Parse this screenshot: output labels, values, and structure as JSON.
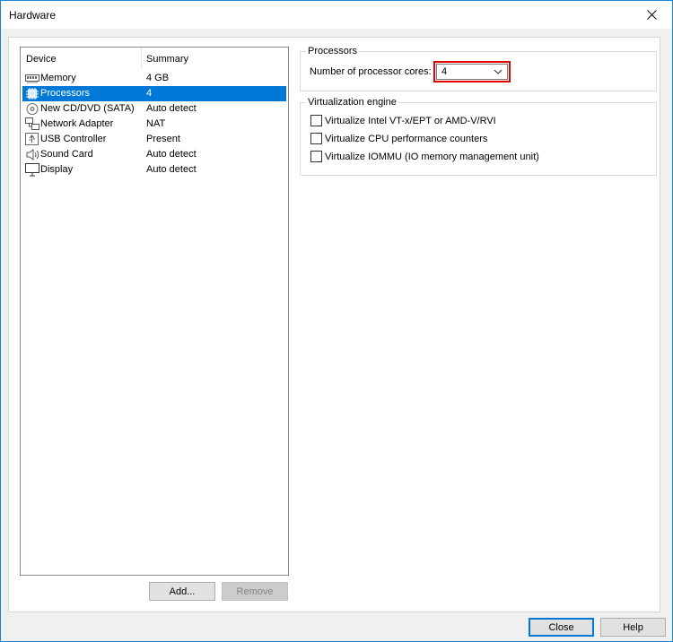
{
  "window": {
    "title": "Hardware"
  },
  "device_list": {
    "columns": [
      "Device",
      "Summary"
    ],
    "items": [
      {
        "device": "Memory",
        "summary": "4 GB",
        "icon": "memory-icon",
        "selected": false
      },
      {
        "device": "Processors",
        "summary": "4",
        "icon": "processor-icon",
        "selected": true
      },
      {
        "device": "New CD/DVD (SATA)",
        "summary": "Auto detect",
        "icon": "cd-dvd-icon",
        "selected": false
      },
      {
        "device": "Network Adapter",
        "summary": "NAT",
        "icon": "network-adapter-icon",
        "selected": false
      },
      {
        "device": "USB Controller",
        "summary": "Present",
        "icon": "usb-icon",
        "selected": false
      },
      {
        "device": "Sound Card",
        "summary": "Auto detect",
        "icon": "sound-card-icon",
        "selected": false
      },
      {
        "device": "Display",
        "summary": "Auto detect",
        "icon": "display-icon",
        "selected": false
      }
    ],
    "add_label": "Add...",
    "remove_label": "Remove"
  },
  "processors": {
    "group_label": "Processors",
    "cores_label": "Number of processor cores:",
    "cores_value": "4"
  },
  "virtualization": {
    "group_label": "Virtualization engine",
    "options": [
      {
        "label": "Virtualize Intel VT-x/EPT or AMD-V/RVI",
        "checked": false
      },
      {
        "label": "Virtualize CPU performance counters",
        "checked": false
      },
      {
        "label": "Virtualize IOMMU (IO memory management unit)",
        "checked": false
      }
    ]
  },
  "footer": {
    "close_label": "Close",
    "help_label": "Help"
  },
  "colors": {
    "selection": "#0078d7",
    "highlight_box": "#e00000"
  }
}
